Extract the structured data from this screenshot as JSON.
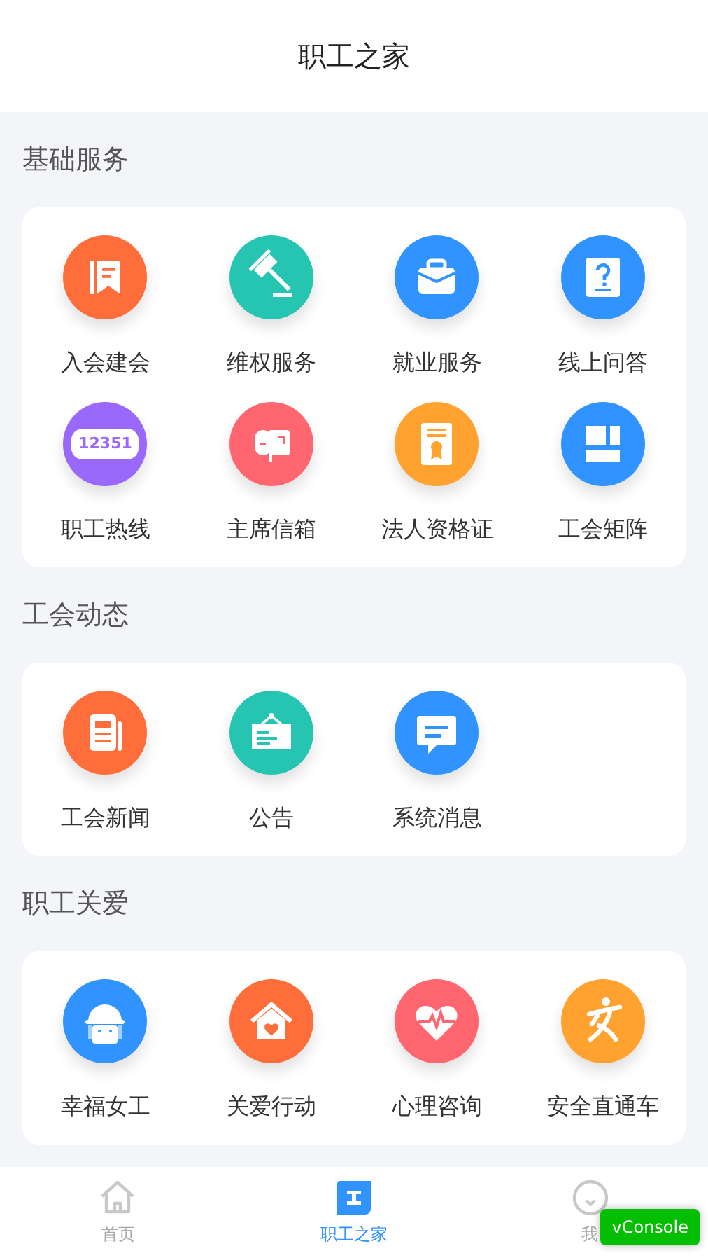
{
  "header": {
    "title": "职工之家"
  },
  "sections": [
    {
      "title": "基础服务",
      "items": [
        {
          "label": "入会建会",
          "kind": "booklet",
          "color": "#ff6d3a"
        },
        {
          "label": "维权服务",
          "kind": "gavel",
          "color": "#25c5b2"
        },
        {
          "label": "就业服务",
          "kind": "briefcase",
          "color": "#3193ff"
        },
        {
          "label": "线上问答",
          "kind": "question",
          "color": "#3193ff"
        },
        {
          "label": "职工热线",
          "kind": "hotline",
          "color": "#9a68fb",
          "code": "12351"
        },
        {
          "label": "主席信箱",
          "kind": "mailbox",
          "color": "#ff6670"
        },
        {
          "label": "法人资格证",
          "kind": "certificate",
          "color": "#ffa22f"
        },
        {
          "label": "工会矩阵",
          "kind": "matrix",
          "color": "#3193ff"
        }
      ]
    },
    {
      "title": "工会动态",
      "items": [
        {
          "label": "工会新闻",
          "kind": "newspaper",
          "color": "#ff6d3a"
        },
        {
          "label": "公告",
          "kind": "notice",
          "color": "#25c5b2"
        },
        {
          "label": "系统消息",
          "kind": "chat",
          "color": "#3193ff"
        }
      ]
    },
    {
      "title": "职工关爱",
      "items": [
        {
          "label": "幸福女工",
          "kind": "worker",
          "color": "#3193ff"
        },
        {
          "label": "关爱行动",
          "kind": "house",
          "color": "#ff6d3a"
        },
        {
          "label": "心理咨询",
          "kind": "heart",
          "color": "#ff6670"
        },
        {
          "label": "安全直通车",
          "kind": "runner",
          "color": "#ffa22f"
        }
      ]
    }
  ],
  "tabbar": [
    {
      "label": "首页",
      "kind": "home",
      "selected": false
    },
    {
      "label": "职工之家",
      "kind": "union",
      "selected": true
    },
    {
      "label": "我",
      "kind": "me",
      "selected": false
    }
  ],
  "console_button": "vConsole"
}
